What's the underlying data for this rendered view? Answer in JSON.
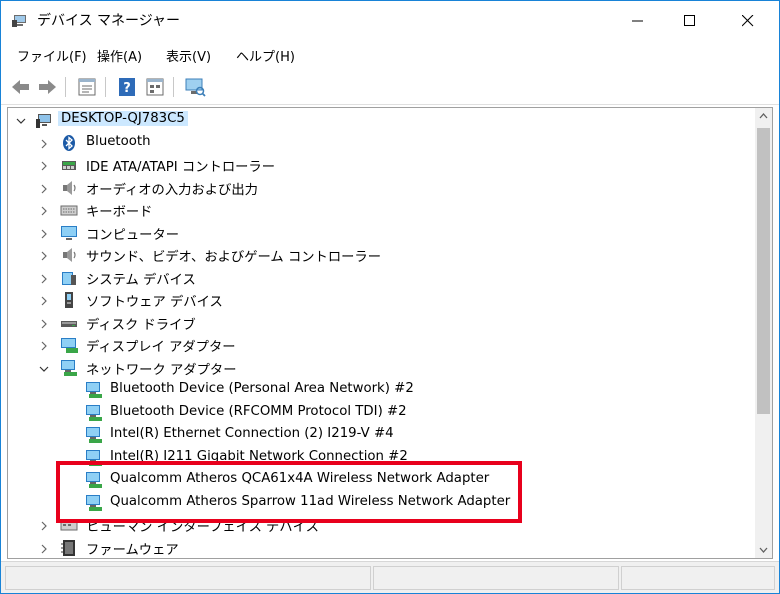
{
  "window": {
    "title": "デバイス マネージャー",
    "border_color": "#1883d7"
  },
  "menu": [
    {
      "label": "ファイル(F)"
    },
    {
      "label": "操作(A)"
    },
    {
      "label": "表示(V)"
    },
    {
      "label": "ヘルプ(H)"
    }
  ],
  "toolbar": [
    {
      "icon": "back-arrow-icon"
    },
    {
      "icon": "forward-arrow-icon"
    },
    {
      "icon": "properties-icon"
    },
    {
      "icon": "help-icon"
    },
    {
      "icon": "view-icon"
    },
    {
      "icon": "scan-hardware-icon"
    }
  ],
  "tree": {
    "root": {
      "label": "DESKTOP-QJ783C5",
      "icon": "computer-icon",
      "expanded": true
    },
    "categories": [
      {
        "label": "Bluetooth",
        "icon": "bluetooth-icon",
        "expanded": false
      },
      {
        "label": "IDE ATA/ATAPI コントローラー",
        "icon": "ide-controller-icon",
        "expanded": false
      },
      {
        "label": "オーディオの入力および出力",
        "icon": "speaker-icon",
        "expanded": false
      },
      {
        "label": "キーボード",
        "icon": "keyboard-icon",
        "expanded": false
      },
      {
        "label": "コンピューター",
        "icon": "monitor-icon",
        "expanded": false
      },
      {
        "label": "サウンド、ビデオ、およびゲーム コントローラー",
        "icon": "speaker-icon",
        "expanded": false
      },
      {
        "label": "システム デバイス",
        "icon": "system-device-icon",
        "expanded": false
      },
      {
        "label": "ソフトウェア デバイス",
        "icon": "software-device-icon",
        "expanded": false
      },
      {
        "label": "ディスク ドライブ",
        "icon": "disk-drive-icon",
        "expanded": false
      },
      {
        "label": "ディスプレイ アダプター",
        "icon": "display-adapter-icon",
        "expanded": false
      },
      {
        "label": "ネットワーク アダプター",
        "icon": "network-adapter-icon",
        "expanded": true,
        "children": [
          {
            "label": "Bluetooth Device (Personal Area Network) #2",
            "icon": "network-adapter-icon"
          },
          {
            "label": "Bluetooth Device (RFCOMM Protocol TDI) #2",
            "icon": "network-adapter-icon"
          },
          {
            "label": "Intel(R) Ethernet Connection (2) I219-V #4",
            "icon": "network-adapter-icon"
          },
          {
            "label": "Intel(R) I211 Gigabit Network Connection #2",
            "icon": "network-adapter-icon"
          },
          {
            "label": "Qualcomm Atheros QCA61x4A Wireless Network Adapter",
            "icon": "network-adapter-icon"
          },
          {
            "label": "Qualcomm Atheros Sparrow 11ad Wireless Network Adapter",
            "icon": "network-adapter-icon"
          }
        ]
      },
      {
        "label": "ヒューマン インターフェイス デバイス",
        "icon": "hid-icon",
        "expanded": false
      },
      {
        "label": "ファームウェア",
        "icon": "firmware-icon",
        "expanded": false
      }
    ]
  },
  "highlight_color": "#e8001c"
}
